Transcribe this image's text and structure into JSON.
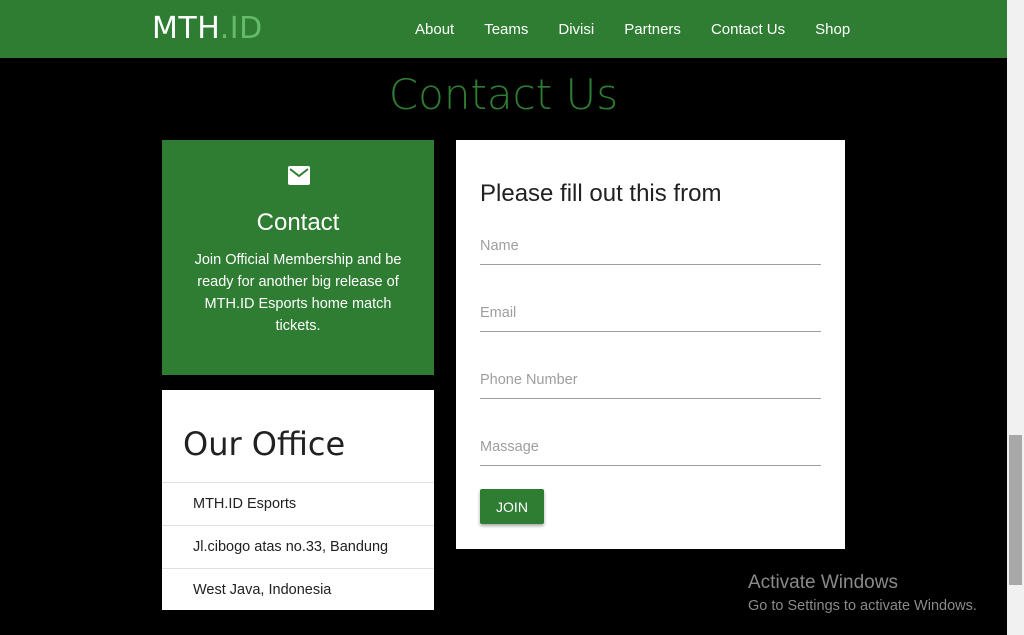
{
  "navbar": {
    "brand": {
      "main": "MTH",
      "accent": ".ID"
    },
    "links": [
      "About",
      "Teams",
      "Divisi",
      "Partners",
      "Contact Us",
      "Shop"
    ]
  },
  "page": {
    "title": "Contact Us"
  },
  "contact_card": {
    "icon": "mail-icon",
    "title": "Contact",
    "text": "Join Official Membership and be ready for another big release of MTH.ID Esports home match tickets."
  },
  "office_card": {
    "title": "Our Office",
    "items": [
      "MTH.ID Esports",
      "Jl.cibogo atas no.33, Bandung",
      "West Java, Indonesia"
    ]
  },
  "form": {
    "title": "Please fill out this from",
    "fields": [
      {
        "placeholder": "Name",
        "value": ""
      },
      {
        "placeholder": "Email",
        "value": ""
      },
      {
        "placeholder": "Phone Number",
        "value": ""
      },
      {
        "placeholder": "Massage",
        "value": ""
      }
    ],
    "submit_label": "JOIN"
  },
  "watermark": {
    "title": "Activate Windows",
    "subtitle": "Go to Settings to activate Windows."
  },
  "colors": {
    "brand_green": "#2e7d32",
    "accent_green": "#66bb6a",
    "background": "#000000"
  }
}
